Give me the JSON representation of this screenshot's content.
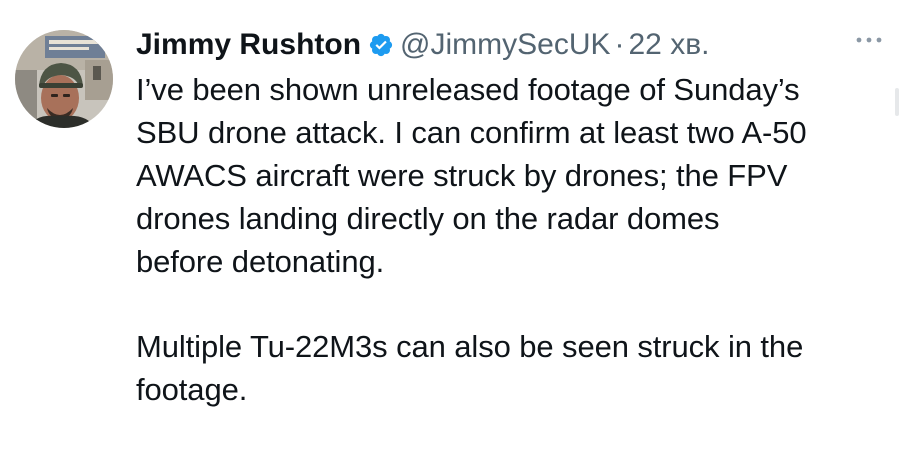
{
  "tweet": {
    "display_name": "Jimmy Rushton",
    "handle": "@JimmySecUK",
    "separator": "·",
    "time": "22 хв.",
    "avatar_icon": "profile-photo",
    "verified_icon": "verified-badge",
    "verified_color": "#1d9bf0",
    "more_icon": "more-options-icon",
    "paragraphs": [
      [
        "I’ve been shown unreleased footage of Sunday’s",
        "SBU drone attack. I can confirm at least two A-50",
        "AWACS aircraft were struck by drones; the FPV",
        "drones landing directly on the radar domes",
        "before detonating."
      ],
      [
        "Multiple Tu-22M3s can also be seen struck in the",
        "footage."
      ]
    ]
  }
}
